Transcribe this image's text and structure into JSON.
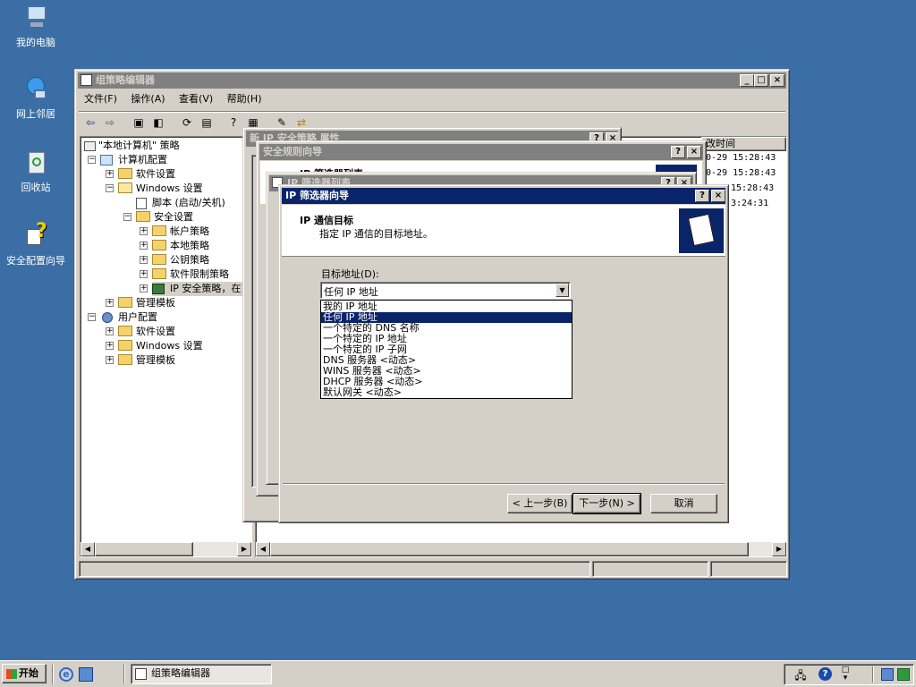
{
  "desktop": {
    "icons": [
      {
        "label": "我的电脑",
        "icon": "my-computer-icon"
      },
      {
        "label": "网上邻居",
        "icon": "network-places-icon"
      },
      {
        "label": "回收站",
        "icon": "recycle-bin-icon"
      },
      {
        "label": "安全配置向导",
        "icon": "security-wizard-icon"
      }
    ]
  },
  "main_window": {
    "title": "组策略编辑器",
    "menu": [
      "文件(F)",
      "操作(A)",
      "查看(V)",
      "帮助(H)"
    ],
    "right_header": "改时间",
    "right_rows": [
      "0-29 15:28:43",
      "0-29 15:28:43",
      "15:28:43",
      "3:24:31"
    ]
  },
  "tree": {
    "root": "\"本地计算机\" 策略",
    "computer_config": "计算机配置",
    "software_settings": "软件设置",
    "windows_settings": "Windows 设置",
    "scripts": "脚本 (启动/关机)",
    "security_settings": "安全设置",
    "account_policies": "帐户策略",
    "local_policies": "本地策略",
    "public_key": "公钥策略",
    "software_restriction": "软件限制策略",
    "ip_security": "IP 安全策略，在",
    "admin_templates": "管理模板",
    "user_config": "用户配置",
    "user_software": "软件设置",
    "user_windows": "Windows 设置",
    "user_admin": "管理模板"
  },
  "bg_dialogs": {
    "props_title": "新 IP 安全策略 属性",
    "rule_wizard_title": "安全规则向导",
    "filter_list_title": "IP 筛选器列表",
    "rule_wizard_text": "IP 筛选器列表"
  },
  "filter_wizard": {
    "title": "IP 筛选器向导",
    "heading": "IP 通信目标",
    "subheading": "指定 IP 通信的目标地址。",
    "field_label": "目标地址(D):",
    "selected": "任何 IP 地址",
    "options": [
      "我的 IP 地址",
      "任何 IP 地址",
      "一个特定的 DNS 名称",
      "一个特定的 IP 地址",
      "一个特定的 IP 子网",
      "DNS 服务器 <动态>",
      "WINS 服务器 <动态>",
      "DHCP 服务器 <动态>",
      "默认网关 <动态>"
    ],
    "highlighted_index": 1,
    "back_button": "< 上一步(B)",
    "next_button": "下一步(N) >",
    "cancel_button": "取消"
  },
  "taskbar": {
    "start_label": "开始",
    "task_label": "组策略编辑器"
  },
  "colors": {
    "desktop": "#3a6ea5",
    "title_active": "#0a246a",
    "title_inactive": "#808080",
    "face": "#d4d0c8"
  }
}
